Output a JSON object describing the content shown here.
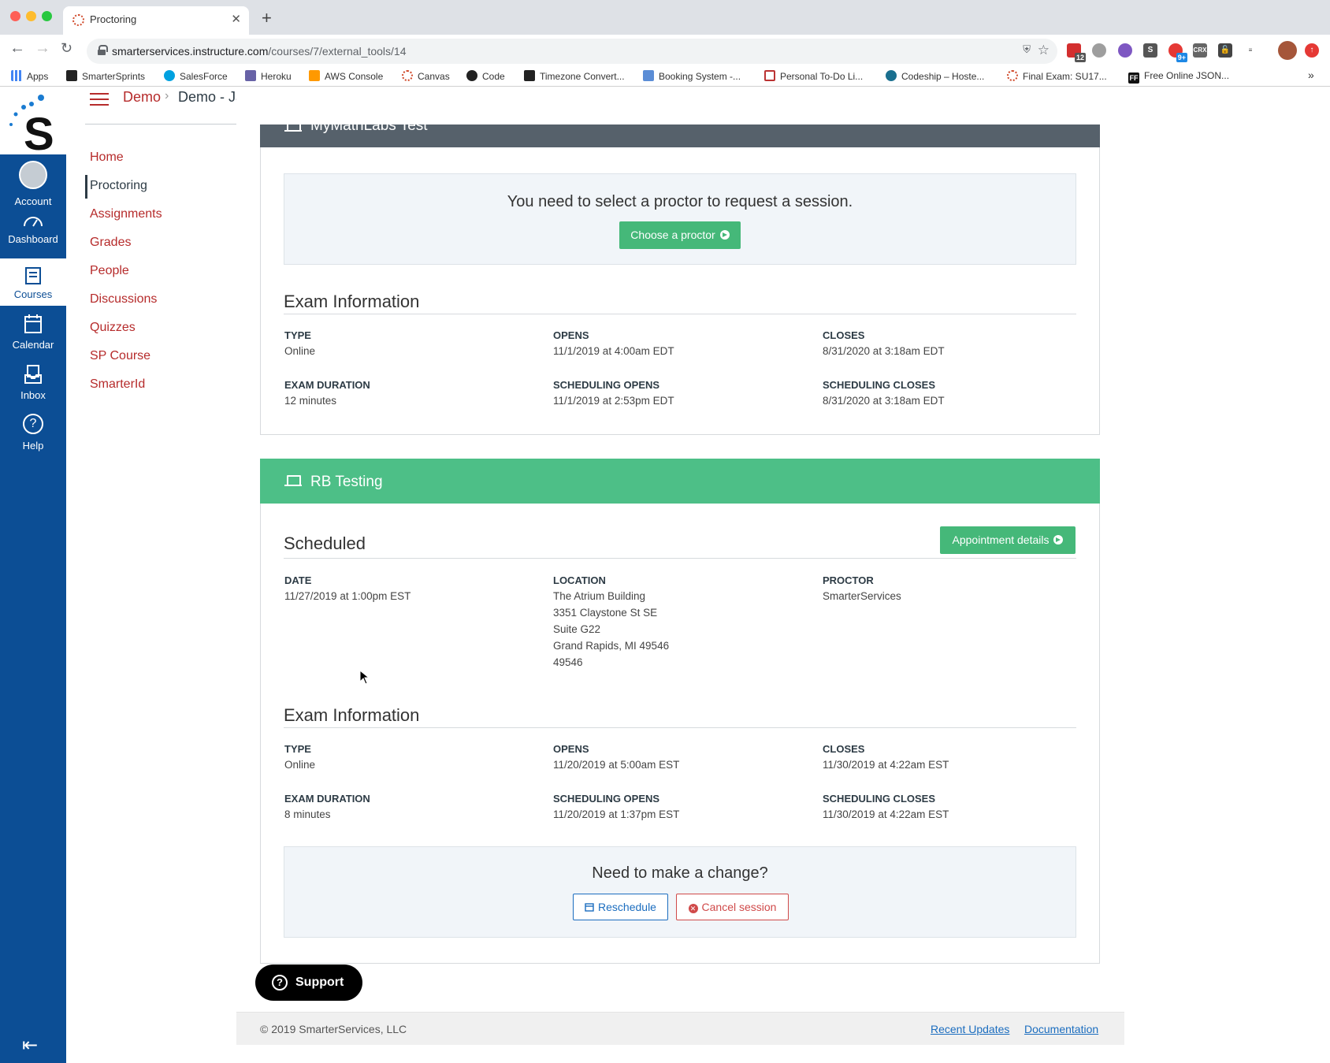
{
  "browser": {
    "tab_title": "Proctoring",
    "url_host": "smarterservices.instructure.com",
    "url_path": "/courses/7/external_tools/14",
    "bookmarks": [
      "Apps",
      "SmarterSprints",
      "SalesForce",
      "Heroku",
      "AWS Console",
      "Canvas",
      "Code",
      "Timezone Convert...",
      "Booking System -...",
      "Personal To-Do Li...",
      "Codeship – Hoste...",
      "Final Exam: SU17...",
      "Free Online JSON..."
    ],
    "extension_badges": [
      "12",
      "9+"
    ]
  },
  "global_nav": {
    "items": [
      "Account",
      "Dashboard",
      "Courses",
      "Calendar",
      "Inbox",
      "Help"
    ]
  },
  "breadcrumb": {
    "course": "Demo",
    "page": "Demo - Jason"
  },
  "course_nav": [
    "Home",
    "Proctoring",
    "Assignments",
    "Grades",
    "People",
    "Discussions",
    "Quizzes",
    "SP Course",
    "SmarterId"
  ],
  "exam1": {
    "title": "MyMathLabs Test",
    "callout": "You need to select a proctor to request a session.",
    "choose_button": "Choose a proctor",
    "info_title": "Exam Information",
    "type_label": "TYPE",
    "type": "Online",
    "opens_label": "OPENS",
    "opens": "11/1/2019 at 4:00am EDT",
    "closes_label": "CLOSES",
    "closes": "8/31/2020 at 3:18am EDT",
    "duration_label": "EXAM DURATION",
    "duration": "12 minutes",
    "sched_opens_label": "SCHEDULING OPENS",
    "sched_opens": "11/1/2019 at 2:53pm EDT",
    "sched_closes_label": "SCHEDULING CLOSES",
    "sched_closes": "8/31/2020 at 3:18am EDT"
  },
  "exam2": {
    "title": "RB Testing",
    "scheduled_title": "Scheduled",
    "appointment_button": "Appointment details",
    "date_label": "DATE",
    "date": "11/27/2019 at 1:00pm EST",
    "location_label": "LOCATION",
    "location": [
      "The Atrium Building",
      "3351 Claystone St SE",
      "Suite G22",
      "Grand Rapids, MI 49546",
      "49546"
    ],
    "proctor_label": "PROCTOR",
    "proctor": "SmarterServices",
    "info_title": "Exam Information",
    "type_label": "TYPE",
    "type": "Online",
    "opens_label": "OPENS",
    "opens": "11/20/2019 at 5:00am EST",
    "closes_label": "CLOSES",
    "closes": "11/30/2019 at 4:22am EST",
    "duration_label": "EXAM DURATION",
    "duration": "8 minutes",
    "sched_opens_label": "SCHEDULING OPENS",
    "sched_opens": "11/20/2019 at 1:37pm EST",
    "sched_closes_label": "SCHEDULING CLOSES",
    "sched_closes": "11/30/2019 at 4:22am EST",
    "change_title": "Need to make a change?",
    "reschedule_button": "Reschedule",
    "cancel_button": "Cancel session"
  },
  "support_button": "Support",
  "footer": {
    "copyright": "© 2019 SmarterServices, LLC",
    "links": [
      "Recent Updates",
      "Documentation"
    ]
  },
  "colors": {
    "canvas_blue": "#0c4e95",
    "link_red": "#b62b2b",
    "green": "#45b879",
    "header_gray": "#56616b"
  }
}
